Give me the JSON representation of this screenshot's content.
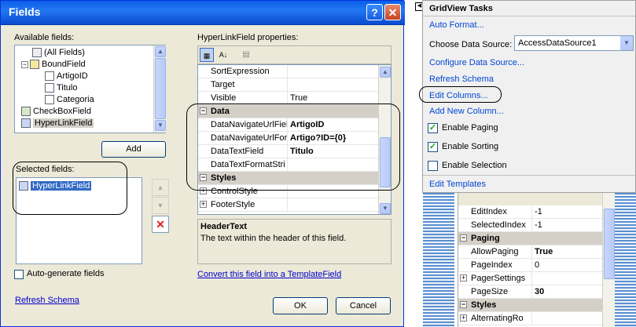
{
  "dialog": {
    "title": "Fields",
    "help_glyph": "?",
    "close_glyph": "✕",
    "available_label": "Available fields:",
    "available_items": [
      "(All Fields)",
      "BoundField",
      "ArtigoID",
      "Titulo",
      "Categoria",
      "CheckBoxField",
      "HyperLinkField"
    ],
    "add_label": "Add",
    "selected_label": "Selected fields:",
    "selected_items": [
      "HyperLinkField"
    ],
    "properties_label": "HyperLinkField properties:",
    "properties": [
      {
        "name": "SortExpression",
        "value": ""
      },
      {
        "name": "Target",
        "value": ""
      },
      {
        "name": "Visible",
        "value": "True"
      },
      {
        "category": "Data"
      },
      {
        "name": "DataNavigateUrlFiel",
        "value": "ArtigoID",
        "bold": true
      },
      {
        "name": "DataNavigateUrlFor",
        "value": "Artigo?ID={0}",
        "bold": true
      },
      {
        "name": "DataTextField",
        "value": "Titulo",
        "bold": true
      },
      {
        "name": "DataTextFormatStri",
        "value": ""
      },
      {
        "category": "Styles"
      },
      {
        "name": "ControlStyle",
        "value": "",
        "expand": true
      },
      {
        "name": "FooterStyle",
        "value": "",
        "expand": true
      }
    ],
    "desc_title": "HeaderText",
    "desc_text": "The text within the header of this field.",
    "auto_generate_label": "Auto-generate fields",
    "convert_link": "Convert this field into a TemplateField",
    "refresh_schema": "Refresh Schema",
    "ok_label": "OK",
    "cancel_label": "Cancel"
  },
  "tasks": {
    "title": "GridView Tasks",
    "auto_format": "Auto Format...",
    "choose_ds_label": "Choose Data Source:",
    "choose_ds_value": "AccessDataSource1",
    "configure_ds": "Configure Data Source...",
    "refresh_schema": "Refresh Schema",
    "edit_columns": "Edit Columns...",
    "add_new_column": "Add New Column...",
    "enable_paging": "Enable Paging",
    "enable_sorting": "Enable Sorting",
    "enable_selection": "Enable Selection",
    "edit_templates": "Edit Templates",
    "paging_checked": true,
    "sorting_checked": true,
    "selection_checked": false
  },
  "bg_properties": [
    {
      "name": "EditIndex",
      "value": "-1"
    },
    {
      "name": "SelectedIndex",
      "value": "-1"
    },
    {
      "category": "Paging"
    },
    {
      "name": "AllowPaging",
      "value": "True",
      "bold": true
    },
    {
      "name": "PageIndex",
      "value": "0"
    },
    {
      "name": "PagerSettings",
      "value": "",
      "expand": true
    },
    {
      "name": "PageSize",
      "value": "30",
      "bold": true
    },
    {
      "category": "Styles"
    },
    {
      "name": "AlternatingRo",
      "value": "",
      "expand": true
    }
  ],
  "colors": {
    "title_bar": "#0a5fe6",
    "dialog_bg": "#ece9d8",
    "link": "#0046d5",
    "selection": "#316ac5"
  }
}
